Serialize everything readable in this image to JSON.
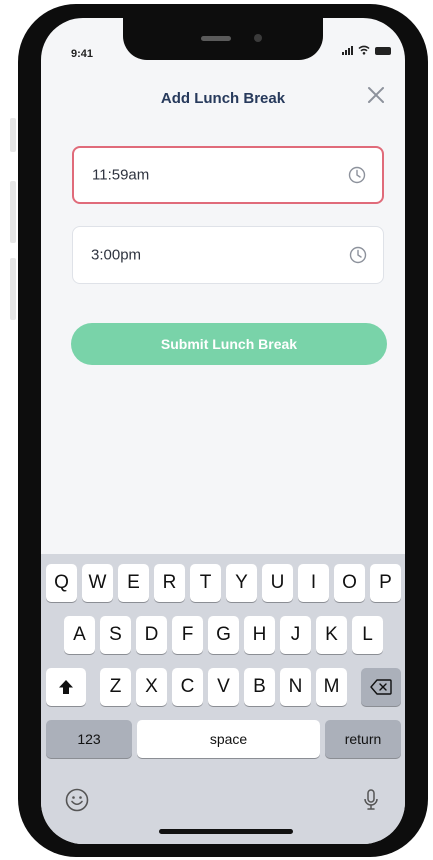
{
  "status_bar": {
    "time": "9:41"
  },
  "header": {
    "title": "Add Lunch Break"
  },
  "form": {
    "start_time": "11:59am",
    "end_time": "3:00pm",
    "submit_label": "Submit Lunch Break"
  },
  "keyboard": {
    "row1": [
      "Q",
      "W",
      "E",
      "R",
      "T",
      "Y",
      "U",
      "I",
      "O",
      "P"
    ],
    "row2": [
      "A",
      "S",
      "D",
      "F",
      "G",
      "H",
      "J",
      "K",
      "L"
    ],
    "row3": [
      "Z",
      "X",
      "C",
      "V",
      "B",
      "N",
      "M"
    ],
    "numbers_label": "123",
    "space_label": "space",
    "return_label": "return"
  },
  "colors": {
    "accent_green": "#79d3a9",
    "error_border": "#e06b7a",
    "title": "#273a5c"
  },
  "icons": [
    "close-icon",
    "clock-icon",
    "shift-icon",
    "backspace-icon",
    "emoji-icon",
    "microphone-icon",
    "signal-icon",
    "wifi-icon",
    "battery-icon"
  ]
}
